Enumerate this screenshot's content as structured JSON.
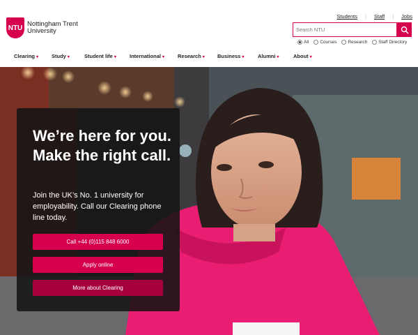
{
  "logo": {
    "badge": "NTU",
    "line1": "Nottingham Trent",
    "line2": "University"
  },
  "utility_links": [
    "Students",
    "Staff",
    "Jobs"
  ],
  "search": {
    "placeholder": "Search NTU"
  },
  "search_scopes": [
    {
      "label": "All",
      "selected": true
    },
    {
      "label": "Courses",
      "selected": false
    },
    {
      "label": "Research",
      "selected": false
    },
    {
      "label": "Staff Directory",
      "selected": false
    }
  ],
  "nav": [
    "Clearing",
    "Study",
    "Student life",
    "International",
    "Research",
    "Business",
    "Alumni",
    "About"
  ],
  "hero": {
    "title": "We’re here for you. Make the right call.",
    "body": "Join the UK’s No. 1 university for employability. Call our Clearing phone line today.",
    "buttons": [
      "Call +44 (0)115 848 6000",
      "Apply online",
      "More about Clearing"
    ]
  },
  "colors": {
    "brand": "#d6004e",
    "brand_dark": "#a6003c",
    "card_bg": "#141414"
  },
  "icons": {
    "search": "search-icon",
    "logo": "ntu-shield-logo",
    "nav_caret": "caret-down-icon"
  }
}
